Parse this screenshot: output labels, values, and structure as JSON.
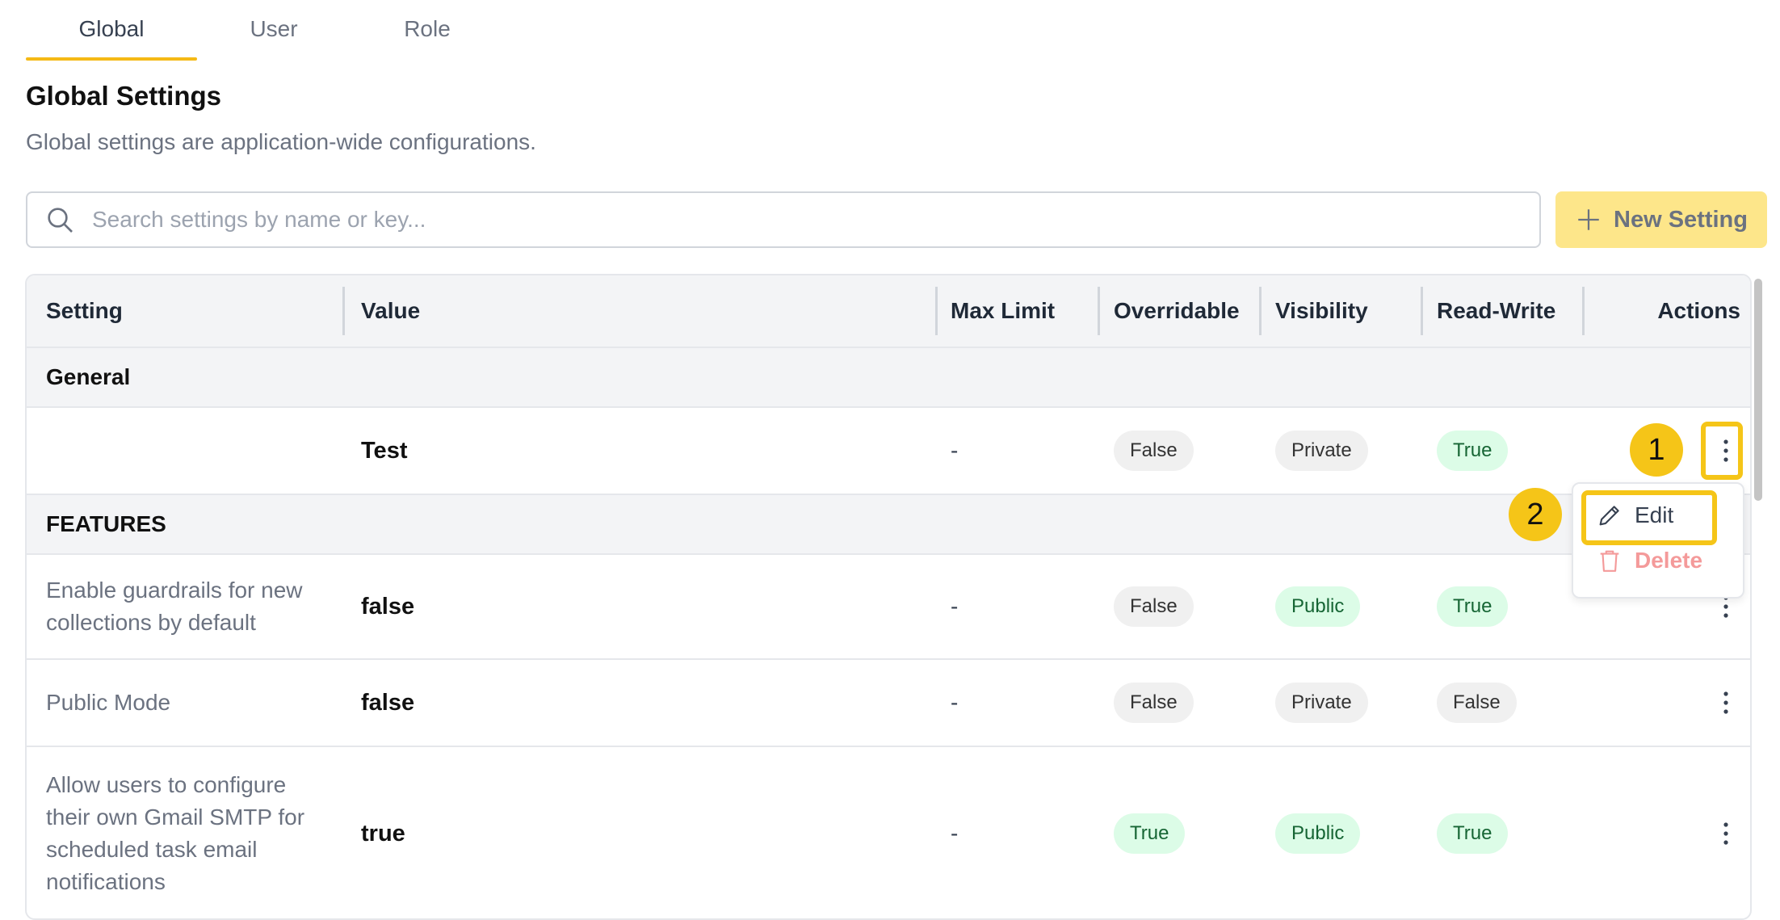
{
  "tabs": [
    {
      "label": "Global",
      "active": true
    },
    {
      "label": "User",
      "active": false
    },
    {
      "label": "Role",
      "active": false
    }
  ],
  "page": {
    "title": "Global Settings",
    "description": "Global settings are application-wide configurations."
  },
  "search": {
    "placeholder": "Search settings by name or key..."
  },
  "new_button": {
    "label": "New Setting"
  },
  "table": {
    "columns": [
      "Setting",
      "Value",
      "Max Limit",
      "Overridable",
      "Visibility",
      "Read-Write",
      "Actions"
    ],
    "groups": [
      {
        "name": "General",
        "rows": [
          {
            "setting": "",
            "value": "Test",
            "max_limit": "-",
            "overridable": "False",
            "visibility": "Private",
            "read_write": "True"
          }
        ]
      },
      {
        "name": "FEATURES",
        "rows": [
          {
            "setting_lines": [
              "Enable guardrails for new",
              "collections by default"
            ],
            "value": "false",
            "max_limit": "-",
            "overridable": "False",
            "visibility": "Public",
            "read_write": "True"
          },
          {
            "setting_lines": [
              "Public Mode"
            ],
            "value": "false",
            "max_limit": "-",
            "overridable": "False",
            "visibility": "Private",
            "read_write": "False"
          },
          {
            "setting_lines": [
              "Allow users to configure",
              "their own Gmail SMTP for",
              "scheduled task email",
              "notifications"
            ],
            "value": "true",
            "max_limit": "-",
            "overridable": "True",
            "visibility": "Public",
            "read_write": "True"
          }
        ]
      }
    ]
  },
  "action_menu": {
    "edit_label": "Edit",
    "delete_label": "Delete"
  },
  "annotations": {
    "step1": "1",
    "step2": "2"
  },
  "colors": {
    "accent": "#f5c518",
    "true_badge_bg": "#dcfce7",
    "false_badge_bg": "#f0f0f0",
    "delete": "#f49a9a"
  }
}
